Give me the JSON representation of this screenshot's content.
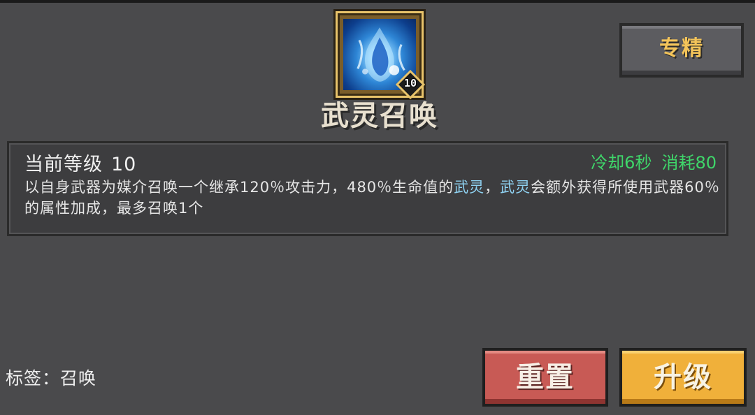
{
  "skill": {
    "name": "武灵召唤",
    "icon": "blue-spirit-icon",
    "level_badge": "10"
  },
  "buttons": {
    "specialization": "专精",
    "reset": "重置",
    "upgrade": "升级"
  },
  "panel": {
    "level_label": "当前等级",
    "level_value": "10",
    "cooldown": "冷却6秒",
    "cost": "消耗80",
    "description": {
      "part1": "以自身武器为媒介召唤一个继承120％攻击力，480％生命值的",
      "hl1": "武灵",
      "part2": "，",
      "hl2": "武灵",
      "part3": "会额外获得所使用武器60％的属性加成，最多召唤1个"
    }
  },
  "tag_line": "标签：召唤",
  "colors": {
    "background": "#4a4a4c",
    "cost_green": "#3fd66a",
    "highlight_cyan": "#8fd2f2",
    "spec_text_gold": "#f3c45a",
    "reset_red": "#c85a55",
    "upgrade_orange": "#f0b03a",
    "icon_frame_gold": "#e8c36a"
  }
}
